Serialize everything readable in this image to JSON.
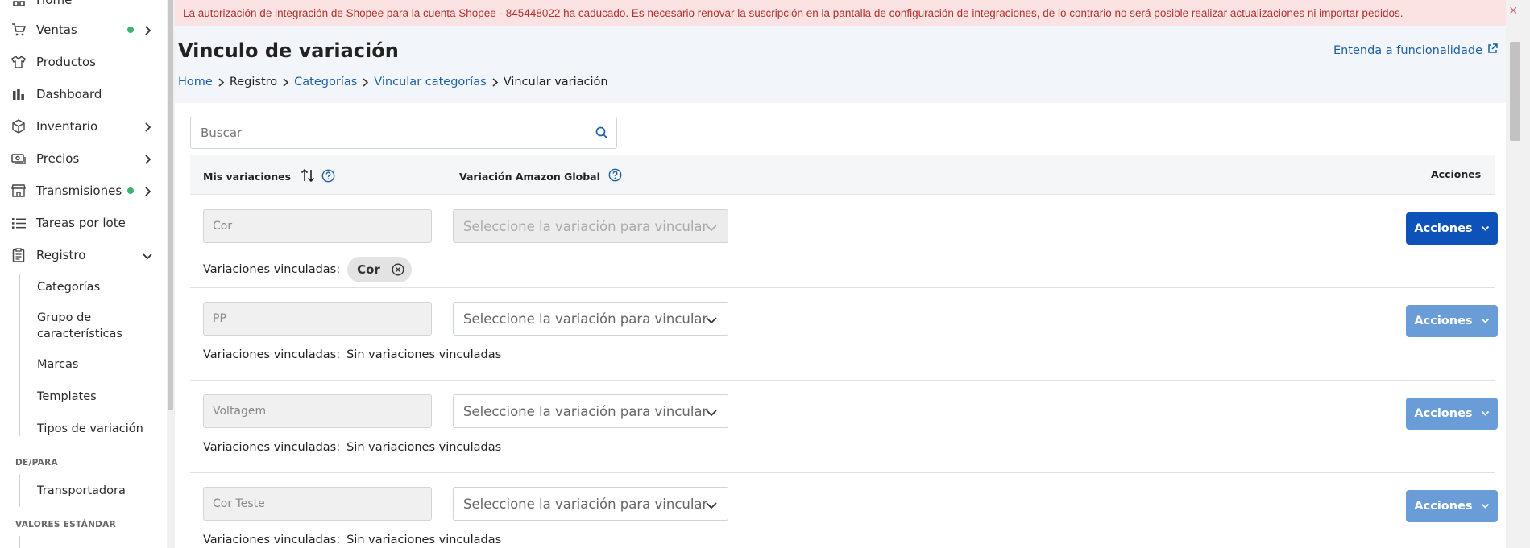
{
  "sidebar": {
    "items": [
      {
        "label": "Home",
        "icon": "home-icon"
      },
      {
        "label": "Ventas",
        "icon": "cart-icon",
        "dot": true,
        "chevron": true
      },
      {
        "label": "Productos",
        "icon": "shirt-icon"
      },
      {
        "label": "Dashboard",
        "icon": "bar-chart-icon"
      },
      {
        "label": "Inventario",
        "icon": "box-icon",
        "chevron": true
      },
      {
        "label": "Precios",
        "icon": "money-icon",
        "chevron": true
      },
      {
        "label": "Transmisiones",
        "icon": "store-icon",
        "dot": true,
        "chevron": true
      },
      {
        "label": "Tareas por lote",
        "icon": "list-icon"
      },
      {
        "label": "Registro",
        "icon": "clipboard-icon",
        "chevron": "down"
      }
    ],
    "registro_sub": [
      "Categorías",
      "Grupo de características",
      "Marcas",
      "Templates",
      "Tipos de variación"
    ],
    "section_depara": "DE/PARA",
    "depara_sub": [
      "Transportadora"
    ],
    "section_valores": "VALORES ESTÁNDAR",
    "dot_color": "#3cb371"
  },
  "alert": {
    "text": "La autorización de integración de Shopee para la cuenta Shopee - 845448022 ha caducado. Es necesario renovar la suscripción en la pantalla de configuración de integraciones, de lo contrario no será posible realizar actualizaciones ni importar pedidos.",
    "close": "×"
  },
  "header": {
    "title": "Vinculo de variación",
    "learn_link": "Entenda a funcionalidade",
    "breadcrumb": [
      {
        "label": "Home",
        "link": true
      },
      {
        "label": "Registro",
        "link": false
      },
      {
        "label": "Categorías",
        "link": true
      },
      {
        "label": "Vincular categorías",
        "link": true
      },
      {
        "label": "Vincular variación",
        "link": false
      }
    ]
  },
  "search": {
    "placeholder": "Buscar",
    "value": ""
  },
  "table": {
    "col_mine": "Mis variaciones",
    "col_amazon": "Variación Amazon Global",
    "col_actions": "Acciones",
    "linked_label": "Variaciones vinculadas:",
    "none_linked": "Sin variaciones vinculadas",
    "select_placeholder": "Seleccione la variación para vincular",
    "action_button": "Acciones",
    "rows": [
      {
        "name": "Cor",
        "linked": [
          "Cor"
        ],
        "disabled": true
      },
      {
        "name": "PP",
        "linked": [],
        "disabled": false
      },
      {
        "name": "Voltagem",
        "linked": [],
        "disabled": false
      },
      {
        "name": "Cor Teste",
        "linked": [],
        "disabled": false
      }
    ]
  },
  "colors": {
    "primary": "#0d52b8",
    "muted_button": "#6a9dd8",
    "link": "#1b5fa8",
    "alert_bg": "#fbe3e3",
    "alert_text": "#b3312e"
  }
}
